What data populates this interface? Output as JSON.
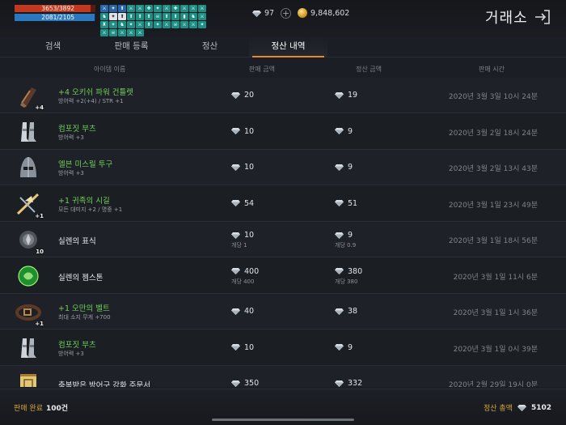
{
  "status": {
    "hp_text": "3653/3892",
    "hp_fraction": 0.94,
    "mp_text": "2081/2105",
    "mp_fraction": 0.99
  },
  "buffs": [
    "⚔",
    "✦",
    "⬆",
    "⚔",
    "⚔",
    "✚",
    "✦",
    "⚔",
    "✚",
    "⚔",
    "⚔",
    "⚔",
    "♞",
    "✦",
    "⬆",
    "⬆",
    "⬆",
    "⬆",
    "☠",
    "⬆",
    "⬆",
    "▮",
    "♞",
    "⚔",
    "♜",
    "✦",
    "♞",
    "✦",
    "⚔",
    "⬆",
    "✦",
    "⚔",
    "☠",
    "⚔",
    "⚔",
    "✦",
    "⚔",
    "☠",
    "⚔",
    "⚔",
    "⚔"
  ],
  "currency": {
    "diamonds": "97",
    "gold": "9,848,602"
  },
  "title": "거래소",
  "tabs": [
    {
      "label": "검색",
      "active": false
    },
    {
      "label": "판매 등록",
      "active": false
    },
    {
      "label": "정산",
      "active": false
    },
    {
      "label": "정산 내역",
      "active": true
    }
  ],
  "columns": {
    "name": "아이템 이름",
    "sale": "판매 금액",
    "settle": "정산 금액",
    "time": "판매 시간"
  },
  "rows": [
    {
      "icon": "gauntlet",
      "enh": "+4",
      "name": "+4 오키쉬 파워 건틀렛",
      "green": true,
      "stat": "방어력 +2(+4) / STR +1",
      "sale": "20",
      "sale_sub": "",
      "settle": "19",
      "settle_sub": "",
      "time": "2020년 3월 3일 10시 24분"
    },
    {
      "icon": "boots",
      "enh": "",
      "name": "컴포짓 부츠",
      "green": true,
      "stat": "방어력 +3",
      "sale": "10",
      "sale_sub": "",
      "settle": "9",
      "settle_sub": "",
      "time": "2020년 3월 2일 18시 24분"
    },
    {
      "icon": "helm",
      "enh": "",
      "name": "엘븐 미스릴 투구",
      "green": true,
      "stat": "방어력 +3",
      "sale": "10",
      "sale_sub": "",
      "settle": "9",
      "settle_sub": "",
      "time": "2020년 3월 2일 13시 43분"
    },
    {
      "icon": "bow",
      "enh": "+1",
      "name": "+1 귀족의 시길",
      "green": true,
      "stat": "모든 대미지 +2 / 명중 +1",
      "sale": "54",
      "sale_sub": "",
      "settle": "51",
      "settle_sub": "",
      "time": "2020년 3월 1일 23시 49분"
    },
    {
      "icon": "token",
      "enh": "10",
      "name": "실렌의 표식",
      "green": false,
      "stat": "",
      "sale": "10",
      "sale_sub": "개당 1",
      "settle": "9",
      "settle_sub": "개당 0.9",
      "time": "2020년 3월 1일 18시 56분"
    },
    {
      "icon": "gem",
      "enh": "",
      "name": "실렌의 젬스톤",
      "green": false,
      "stat": "",
      "sale": "400",
      "sale_sub": "개당 400",
      "settle": "380",
      "settle_sub": "개당 380",
      "time": "2020년 3월 1일 11시 6분"
    },
    {
      "icon": "belt",
      "enh": "+1",
      "name": "+1 오만의 벨트",
      "green": true,
      "stat": "최대 소지 무게 +700",
      "sale": "40",
      "sale_sub": "",
      "settle": "38",
      "settle_sub": "",
      "time": "2020년 3월 1일 1시 36분"
    },
    {
      "icon": "boots",
      "enh": "",
      "name": "컴포짓 부츠",
      "green": true,
      "stat": "방어력 +3",
      "sale": "10",
      "sale_sub": "",
      "settle": "9",
      "settle_sub": "",
      "time": "2020년 3월 1일 0시 39분"
    },
    {
      "icon": "scroll",
      "enh": "",
      "name": "축복받은 방어구 강화 주문서",
      "green": false,
      "stat": "",
      "sale": "350",
      "sale_sub": "",
      "settle": "332",
      "settle_sub": "",
      "time": "2020년 2월 29일 19시 0분"
    }
  ],
  "footer": {
    "completed_label": "판매 완료",
    "completed_value": "100건",
    "total_label": "정산 총액",
    "total_value": "5102"
  }
}
